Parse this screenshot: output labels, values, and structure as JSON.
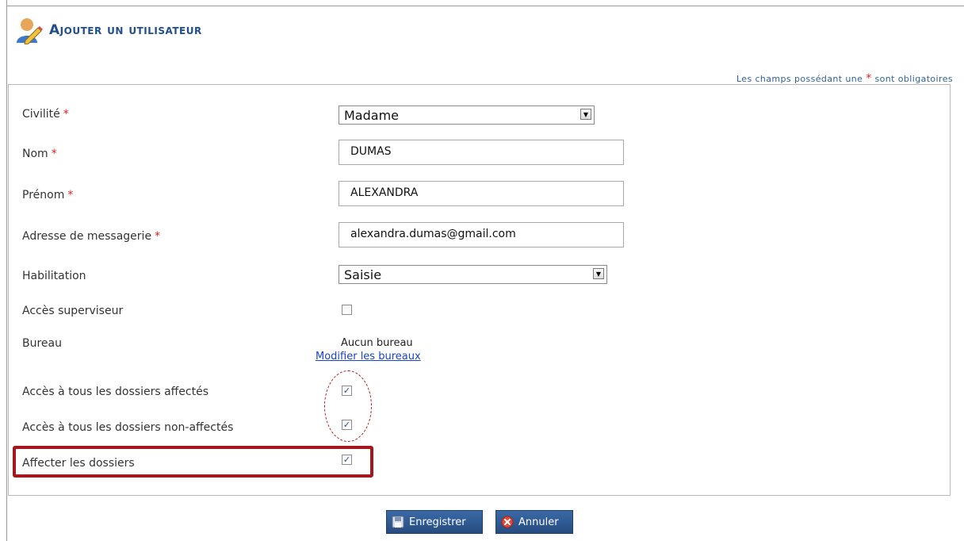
{
  "header": {
    "title": "Ajouter un utilisateur",
    "required_note_prefix": "Les champs possédant une ",
    "required_note_star": "*",
    "required_note_suffix": " sont obligatoires"
  },
  "form": {
    "civilite": {
      "label": "Civilité",
      "required": "*",
      "value": "Madame"
    },
    "nom": {
      "label": "Nom",
      "required": "*",
      "value": "DUMAS"
    },
    "prenom": {
      "label": "Prénom",
      "required": "*",
      "value": "ALEXANDRA"
    },
    "email": {
      "label": "Adresse de messagerie",
      "required": "*",
      "value": "alexandra.dumas@gmail.com"
    },
    "habilitation": {
      "label": "Habilitation",
      "value": "Saisie"
    },
    "superviseur": {
      "label": "Accès superviseur",
      "checked": false
    },
    "bureau": {
      "label": "Bureau",
      "value": "Aucun bureau",
      "link": "Modifier les bureaux"
    },
    "dossiers_affectes": {
      "label": "Accès à tous les dossiers affectés",
      "checked": true
    },
    "dossiers_non_affectes": {
      "label": "Accès à tous les dossiers non-affectés",
      "checked": true
    },
    "affecter_dossiers": {
      "label": "Affecter les dossiers",
      "checked": true
    }
  },
  "buttons": {
    "save": "Enregistrer",
    "cancel": "Annuler"
  },
  "colors": {
    "title": "#1f4e8c",
    "required_star": "#e02020",
    "highlight": "#a3171d",
    "button": "#2f5b94"
  },
  "icons": {
    "title": "user-edit-icon",
    "save": "floppy-disk-icon",
    "cancel": "red-x-icon",
    "dropdown": "dropdown-arrow-icon",
    "checkbox": "checkmark-icon"
  }
}
